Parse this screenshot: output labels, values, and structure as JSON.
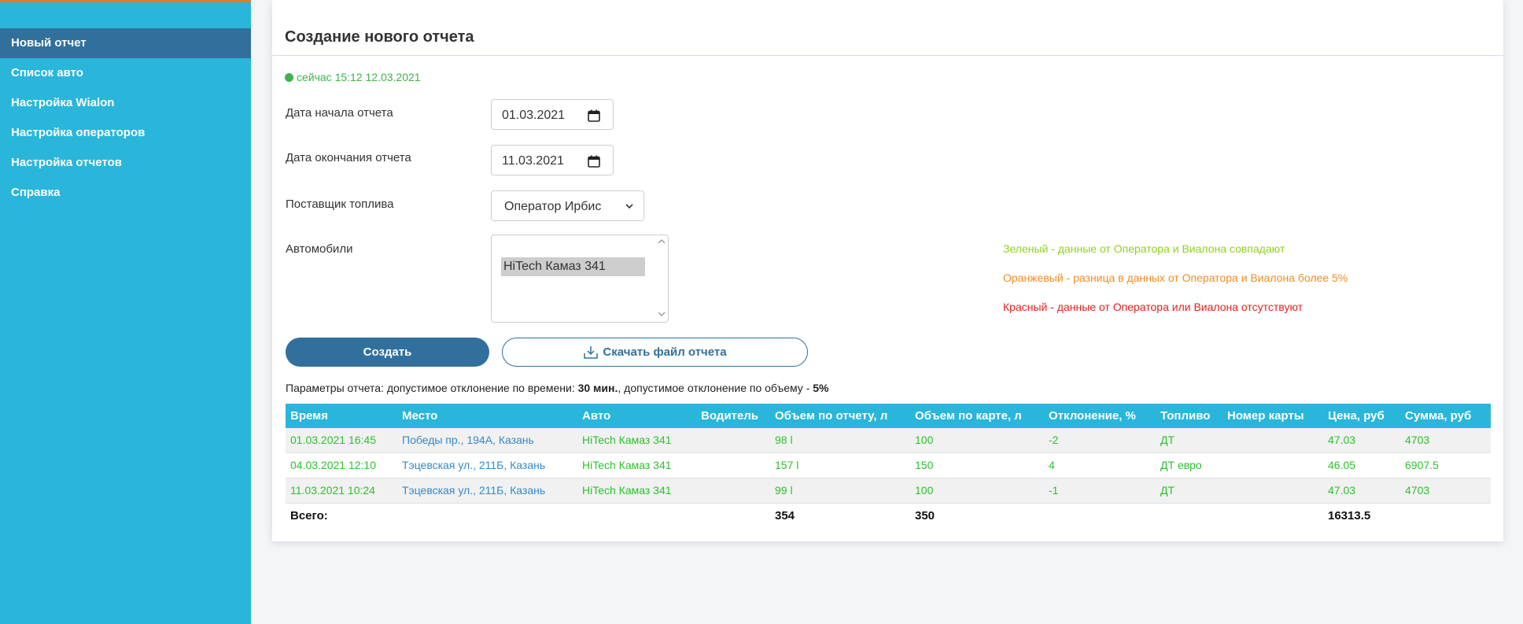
{
  "sidebar": {
    "items": [
      {
        "label": "Новый отчет",
        "active": true
      },
      {
        "label": "Список авто"
      },
      {
        "label": "Настройка Wialon"
      },
      {
        "label": "Настройка операторов"
      },
      {
        "label": "Настройка отчетов"
      },
      {
        "label": "Справка"
      }
    ]
  },
  "page": {
    "title": "Создание нового отчета",
    "status_text": "сейчас 15:12 12.03.2021"
  },
  "form": {
    "start_label": "Дата начала отчета",
    "start_value": "01.03.2021",
    "end_label": "Дата окончания отчета",
    "end_value": "11.03.2021",
    "supplier_label": "Поставщик топлива",
    "supplier_value": "Оператор Ирбис",
    "cars_label": "Автомобили",
    "cars_selected": "HiTech Камаз 341"
  },
  "legend": {
    "green": "Зеленый - данные от Оператора и Виалона совпадают",
    "orange": "Оранжевый - разница в данных от Оператора и Виалона более 5%",
    "red": "Красный - данные от Оператора или Виалона отсутствуют",
    "colors": {
      "green": "#8fd11f",
      "orange": "#f08c24",
      "red": "#e81f1f"
    }
  },
  "buttons": {
    "create": "Создать",
    "download": "Скачать файл отчета"
  },
  "params": {
    "prefix": "Параметры отчета: допустимое отклонение по времени: ",
    "time_value": "30 мин.",
    "middle": ", допустимое отклонение по объему - ",
    "volume_value": "5%"
  },
  "table": {
    "headers": [
      "Время",
      "Место",
      "Авто",
      "Водитель",
      "Объем по отчету, л",
      "Объем по карте, л",
      "Отклонение, %",
      "Топливо",
      "Номер карты",
      "Цена, руб",
      "Сумма, руб"
    ],
    "rows": [
      [
        "01.03.2021 16:45",
        "Победы пр., 194А, Казань",
        "HiTech Камаз 341",
        "",
        "98 l",
        "100",
        "-2",
        "ДТ",
        "",
        "47.03",
        "4703"
      ],
      [
        "04.03.2021 12:10",
        "Тэцевская ул., 211Б, Казань",
        "HiTech Камаз 341",
        "",
        "157 l",
        "150",
        "4",
        "ДТ евро",
        "",
        "46.05",
        "6907.5"
      ],
      [
        "11.03.2021 10:24",
        "Тэцевская ул., 211Б, Казань",
        "HiTech Камаз 341",
        "",
        "99 l",
        "100",
        "-1",
        "ДТ",
        "",
        "47.03",
        "4703"
      ]
    ],
    "total": {
      "label": "Всего:",
      "report_volume": "354",
      "card_volume": "350",
      "sum": "16313.5"
    }
  },
  "colors": {
    "sidebar": "#29b6da",
    "sidebar_active": "#31709c",
    "accent": "#31709c",
    "row_green": "#2cc12c",
    "link_blue": "#3589c9"
  }
}
